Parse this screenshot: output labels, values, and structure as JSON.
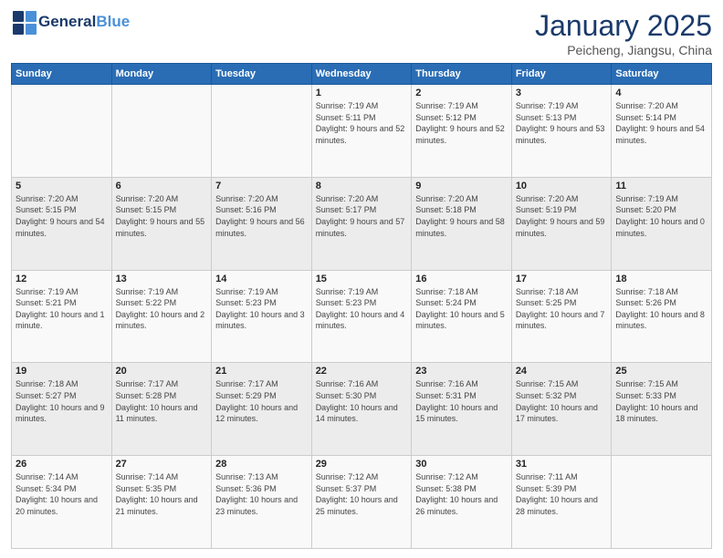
{
  "header": {
    "logo_line1": "General",
    "logo_line2": "Blue",
    "month_title": "January 2025",
    "subtitle": "Peicheng, Jiangsu, China"
  },
  "weekdays": [
    "Sunday",
    "Monday",
    "Tuesday",
    "Wednesday",
    "Thursday",
    "Friday",
    "Saturday"
  ],
  "weeks": [
    [
      {
        "day": "",
        "sunrise": "",
        "sunset": "",
        "daylight": ""
      },
      {
        "day": "",
        "sunrise": "",
        "sunset": "",
        "daylight": ""
      },
      {
        "day": "",
        "sunrise": "",
        "sunset": "",
        "daylight": ""
      },
      {
        "day": "1",
        "sunrise": "Sunrise: 7:19 AM",
        "sunset": "Sunset: 5:11 PM",
        "daylight": "Daylight: 9 hours and 52 minutes."
      },
      {
        "day": "2",
        "sunrise": "Sunrise: 7:19 AM",
        "sunset": "Sunset: 5:12 PM",
        "daylight": "Daylight: 9 hours and 52 minutes."
      },
      {
        "day": "3",
        "sunrise": "Sunrise: 7:19 AM",
        "sunset": "Sunset: 5:13 PM",
        "daylight": "Daylight: 9 hours and 53 minutes."
      },
      {
        "day": "4",
        "sunrise": "Sunrise: 7:20 AM",
        "sunset": "Sunset: 5:14 PM",
        "daylight": "Daylight: 9 hours and 54 minutes."
      }
    ],
    [
      {
        "day": "5",
        "sunrise": "Sunrise: 7:20 AM",
        "sunset": "Sunset: 5:15 PM",
        "daylight": "Daylight: 9 hours and 54 minutes."
      },
      {
        "day": "6",
        "sunrise": "Sunrise: 7:20 AM",
        "sunset": "Sunset: 5:15 PM",
        "daylight": "Daylight: 9 hours and 55 minutes."
      },
      {
        "day": "7",
        "sunrise": "Sunrise: 7:20 AM",
        "sunset": "Sunset: 5:16 PM",
        "daylight": "Daylight: 9 hours and 56 minutes."
      },
      {
        "day": "8",
        "sunrise": "Sunrise: 7:20 AM",
        "sunset": "Sunset: 5:17 PM",
        "daylight": "Daylight: 9 hours and 57 minutes."
      },
      {
        "day": "9",
        "sunrise": "Sunrise: 7:20 AM",
        "sunset": "Sunset: 5:18 PM",
        "daylight": "Daylight: 9 hours and 58 minutes."
      },
      {
        "day": "10",
        "sunrise": "Sunrise: 7:20 AM",
        "sunset": "Sunset: 5:19 PM",
        "daylight": "Daylight: 9 hours and 59 minutes."
      },
      {
        "day": "11",
        "sunrise": "Sunrise: 7:19 AM",
        "sunset": "Sunset: 5:20 PM",
        "daylight": "Daylight: 10 hours and 0 minutes."
      }
    ],
    [
      {
        "day": "12",
        "sunrise": "Sunrise: 7:19 AM",
        "sunset": "Sunset: 5:21 PM",
        "daylight": "Daylight: 10 hours and 1 minute."
      },
      {
        "day": "13",
        "sunrise": "Sunrise: 7:19 AM",
        "sunset": "Sunset: 5:22 PM",
        "daylight": "Daylight: 10 hours and 2 minutes."
      },
      {
        "day": "14",
        "sunrise": "Sunrise: 7:19 AM",
        "sunset": "Sunset: 5:23 PM",
        "daylight": "Daylight: 10 hours and 3 minutes."
      },
      {
        "day": "15",
        "sunrise": "Sunrise: 7:19 AM",
        "sunset": "Sunset: 5:23 PM",
        "daylight": "Daylight: 10 hours and 4 minutes."
      },
      {
        "day": "16",
        "sunrise": "Sunrise: 7:18 AM",
        "sunset": "Sunset: 5:24 PM",
        "daylight": "Daylight: 10 hours and 5 minutes."
      },
      {
        "day": "17",
        "sunrise": "Sunrise: 7:18 AM",
        "sunset": "Sunset: 5:25 PM",
        "daylight": "Daylight: 10 hours and 7 minutes."
      },
      {
        "day": "18",
        "sunrise": "Sunrise: 7:18 AM",
        "sunset": "Sunset: 5:26 PM",
        "daylight": "Daylight: 10 hours and 8 minutes."
      }
    ],
    [
      {
        "day": "19",
        "sunrise": "Sunrise: 7:18 AM",
        "sunset": "Sunset: 5:27 PM",
        "daylight": "Daylight: 10 hours and 9 minutes."
      },
      {
        "day": "20",
        "sunrise": "Sunrise: 7:17 AM",
        "sunset": "Sunset: 5:28 PM",
        "daylight": "Daylight: 10 hours and 11 minutes."
      },
      {
        "day": "21",
        "sunrise": "Sunrise: 7:17 AM",
        "sunset": "Sunset: 5:29 PM",
        "daylight": "Daylight: 10 hours and 12 minutes."
      },
      {
        "day": "22",
        "sunrise": "Sunrise: 7:16 AM",
        "sunset": "Sunset: 5:30 PM",
        "daylight": "Daylight: 10 hours and 14 minutes."
      },
      {
        "day": "23",
        "sunrise": "Sunrise: 7:16 AM",
        "sunset": "Sunset: 5:31 PM",
        "daylight": "Daylight: 10 hours and 15 minutes."
      },
      {
        "day": "24",
        "sunrise": "Sunrise: 7:15 AM",
        "sunset": "Sunset: 5:32 PM",
        "daylight": "Daylight: 10 hours and 17 minutes."
      },
      {
        "day": "25",
        "sunrise": "Sunrise: 7:15 AM",
        "sunset": "Sunset: 5:33 PM",
        "daylight": "Daylight: 10 hours and 18 minutes."
      }
    ],
    [
      {
        "day": "26",
        "sunrise": "Sunrise: 7:14 AM",
        "sunset": "Sunset: 5:34 PM",
        "daylight": "Daylight: 10 hours and 20 minutes."
      },
      {
        "day": "27",
        "sunrise": "Sunrise: 7:14 AM",
        "sunset": "Sunset: 5:35 PM",
        "daylight": "Daylight: 10 hours and 21 minutes."
      },
      {
        "day": "28",
        "sunrise": "Sunrise: 7:13 AM",
        "sunset": "Sunset: 5:36 PM",
        "daylight": "Daylight: 10 hours and 23 minutes."
      },
      {
        "day": "29",
        "sunrise": "Sunrise: 7:12 AM",
        "sunset": "Sunset: 5:37 PM",
        "daylight": "Daylight: 10 hours and 25 minutes."
      },
      {
        "day": "30",
        "sunrise": "Sunrise: 7:12 AM",
        "sunset": "Sunset: 5:38 PM",
        "daylight": "Daylight: 10 hours and 26 minutes."
      },
      {
        "day": "31",
        "sunrise": "Sunrise: 7:11 AM",
        "sunset": "Sunset: 5:39 PM",
        "daylight": "Daylight: 10 hours and 28 minutes."
      },
      {
        "day": "",
        "sunrise": "",
        "sunset": "",
        "daylight": ""
      }
    ]
  ]
}
